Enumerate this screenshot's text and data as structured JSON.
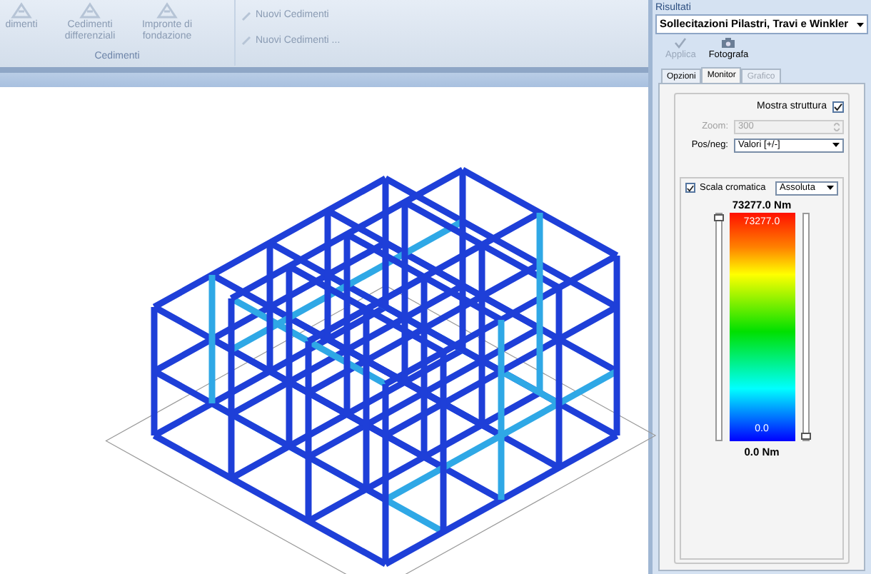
{
  "ribbon": {
    "buttons": [
      {
        "label": "dimenti",
        "disabled": true
      },
      {
        "label": "Cedimenti differenziali",
        "disabled": true
      },
      {
        "label": "Impronte di fondazione",
        "disabled": true
      }
    ],
    "small_buttons": [
      {
        "label": "Nuovi Cedimenti",
        "disabled": true
      },
      {
        "label": "Nuovi Cedimenti ...",
        "disabled": true
      }
    ],
    "group_label": "Cedimenti"
  },
  "results_panel": {
    "title": "Risultati",
    "result_select": "Sollecitazioni Pilastri, Travi e Winkler",
    "toolbar": [
      {
        "label": "Applica",
        "disabled": true
      },
      {
        "label": "Fotografa",
        "disabled": false
      }
    ],
    "tabs": [
      {
        "label": "Opzioni",
        "selected": false,
        "disabled": false
      },
      {
        "label": "Monitor",
        "selected": true,
        "disabled": false
      },
      {
        "label": "Grafico",
        "selected": false,
        "disabled": true
      }
    ],
    "show_structure": {
      "label": "Mostra struttura",
      "checked": true
    },
    "zoom": {
      "label": "Zoom:",
      "value": "300",
      "disabled": true
    },
    "pos_neg": {
      "label": "Pos/neg:",
      "value": "Valori [+/-]"
    },
    "color_scale": {
      "label": "Scala cromatica",
      "checked": true,
      "mode": "Assoluta",
      "max_label": "73277.0 Nm",
      "bar_max": "73277.0",
      "bar_min": "0.0",
      "min_label": "0.0 Nm"
    },
    "max_slider": {
      "level": 1
    },
    "min_slider": {
      "level": 0
    }
  }
}
